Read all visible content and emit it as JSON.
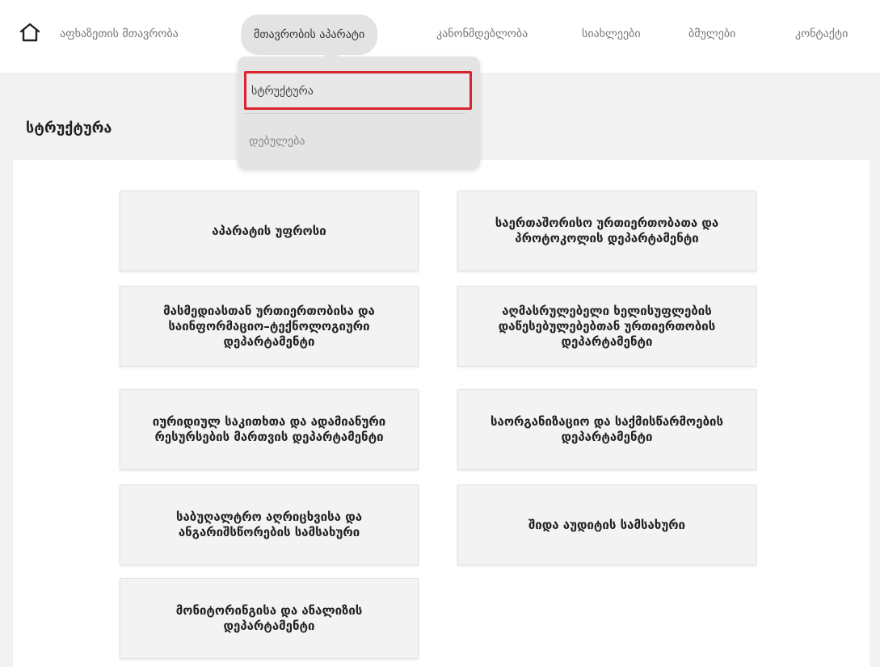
{
  "nav": {
    "items": [
      "აფხაზეთის მთავრობა",
      "მთავრობის აპარატი",
      "კანონმდებლობა",
      "სიახლეები",
      "ბმულები",
      "კონტაქტი"
    ]
  },
  "dropdown": {
    "items": [
      "სტრუქტურა",
      "დებულება"
    ]
  },
  "page": {
    "title": "სტრუქტურა"
  },
  "cards": [
    "აპარატის უფროსი",
    "საერთაშორისო ურთიერთობათა და პროტოკოლის დეპარტამენტი",
    "მასმედიასთან ურთიერთობისა და საინფორმაციო–ტექნოლოგიური დეპარტამენტი",
    "აღმასრულებელი ხელისუფლების დაწესებულებებთან ურთიერთობის დეპარტამენტი",
    "იურიდიულ საკითხთა და ადამიანური რესურსების მართვის დეპარტამენტი",
    "საორგანიზაციო და საქმისწარმოების დეპარტამენტი",
    "საბუღალტრო აღრიცხვისა და ანგარიშსწორების სამსახური",
    "შიდა აუდიტის სამსახური",
    "მონიტორინგისა და ანალიზის დეპარტამენტი"
  ],
  "colors": {
    "highlight_border": "#d9232e",
    "active_tab_bg": "#e3e3e3"
  },
  "icons": {
    "home": "home-icon"
  }
}
